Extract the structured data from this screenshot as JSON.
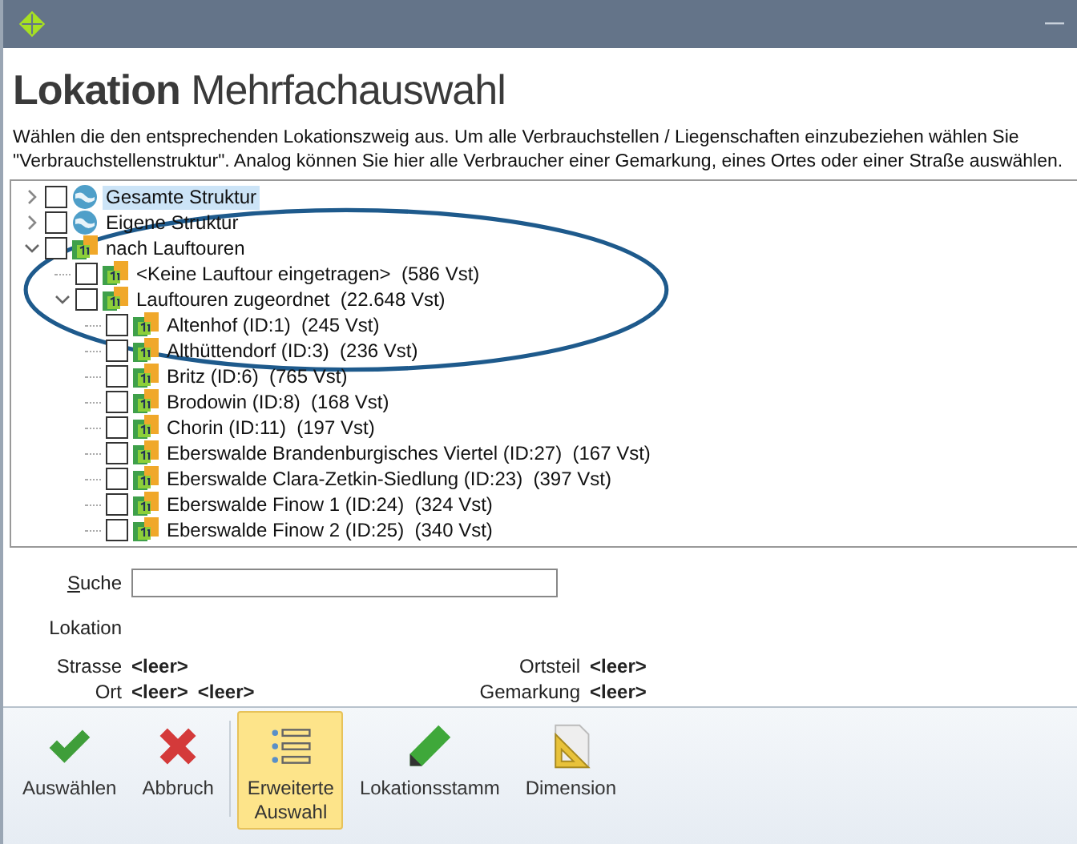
{
  "window": {
    "title": "Lokation",
    "subtitle": "Mehrfachauswahl"
  },
  "description": "Wählen die den entsprechenden Lokationszweig aus. Um alle Verbrauchstellen / Liegenschaften einzubeziehen wählen Sie \"Verbrauchstellenstruktur\". Analog können Sie hier alle Verbraucher einer Gemarkung, eines Ortes oder einer Straße auswählen.",
  "tree": [
    {
      "label": "Gesamte Struktur",
      "kind": "globe",
      "checked": false,
      "selected": true,
      "expanded": false
    },
    {
      "label": "Eigene Struktur",
      "kind": "globe",
      "checked": false,
      "selected": false,
      "expanded": false
    },
    {
      "label": "nach Lauftouren",
      "kind": "tour",
      "checked": false,
      "selected": false,
      "expanded": true,
      "children": [
        {
          "label": "<Keine Lauftour eingetragen>  (586 Vst)",
          "kind": "tour",
          "checked": false,
          "selected": false
        },
        {
          "label": "Lauftouren zugeordnet  (22.648 Vst)",
          "kind": "tour",
          "checked": false,
          "selected": false,
          "expanded": true,
          "children": [
            {
              "label": "Altenhof (ID:1)  (245 Vst)",
              "kind": "tour",
              "checked": false,
              "selected": false
            },
            {
              "label": "Althüttendorf (ID:3)  (236 Vst)",
              "kind": "tour",
              "checked": false,
              "selected": false
            },
            {
              "label": "Britz (ID:6)  (765 Vst)",
              "kind": "tour",
              "checked": false,
              "selected": false
            },
            {
              "label": "Brodowin (ID:8)  (168 Vst)",
              "kind": "tour",
              "checked": false,
              "selected": false
            },
            {
              "label": "Chorin (ID:11)  (197 Vst)",
              "kind": "tour",
              "checked": false,
              "selected": false
            },
            {
              "label": "Eberswalde Brandenburgisches Viertel (ID:27)  (167 Vst)",
              "kind": "tour",
              "checked": false,
              "selected": false
            },
            {
              "label": "Eberswalde Clara-Zetkin-Siedlung (ID:23)  (397 Vst)",
              "kind": "tour",
              "checked": false,
              "selected": false
            },
            {
              "label": "Eberswalde Finow 1 (ID:24)  (324 Vst)",
              "kind": "tour",
              "checked": false,
              "selected": false
            },
            {
              "label": "Eberswalde Finow 2 (ID:25)  (340 Vst)",
              "kind": "tour",
              "checked": false,
              "selected": false
            }
          ]
        }
      ]
    }
  ],
  "search": {
    "label": "Suche"
  },
  "location": {
    "heading": "Lokation",
    "left": [
      {
        "label": "Strasse",
        "values": [
          "<leer>"
        ]
      },
      {
        "label": "Ort",
        "values": [
          "<leer>",
          "<leer>"
        ]
      }
    ],
    "right": [
      {
        "label": "Ortsteil",
        "values": [
          "<leer>"
        ]
      },
      {
        "label": "Gemarkung",
        "values": [
          "<leer>"
        ]
      }
    ]
  },
  "toolbar": [
    {
      "label": "Auswählen",
      "kind": "check",
      "selected": false,
      "separator_after": false
    },
    {
      "label": "Abbruch",
      "kind": "cancel",
      "selected": false,
      "separator_after": true
    },
    {
      "label": "Erweiterte\nAuswahl",
      "kind": "list",
      "selected": true,
      "separator_after": false
    },
    {
      "label": "Lokationsstamm",
      "kind": "pencil",
      "selected": false,
      "separator_after": false
    },
    {
      "label": "Dimension",
      "kind": "triangle",
      "selected": false,
      "separator_after": false
    }
  ]
}
